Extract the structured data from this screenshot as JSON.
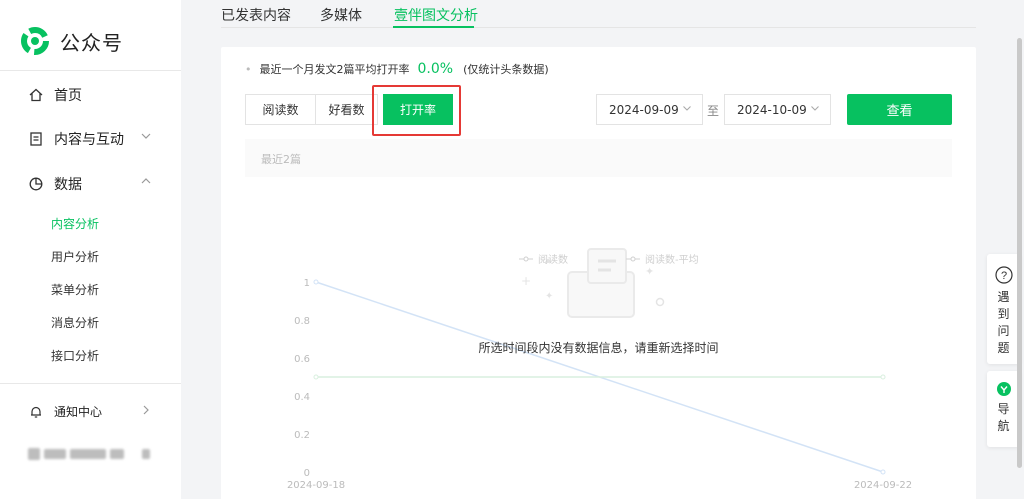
{
  "app": {
    "name": "公众号"
  },
  "sidebar": {
    "home": "首页",
    "content_interaction": "内容与互动",
    "data": "数据",
    "sub_items": [
      "内容分析",
      "用户分析",
      "菜单分析",
      "消息分析",
      "接口分析"
    ],
    "notifications": "通知中心"
  },
  "tabs": [
    "已发表内容",
    "多媒体",
    "壹伴图文分析"
  ],
  "summary": {
    "label": "最近一个月发文2篇平均打开率",
    "value": "0.0%",
    "note": "(仅统计头条数据)"
  },
  "segments": [
    "阅读数",
    "好看数",
    "打开率"
  ],
  "date_range": {
    "start": "2024-09-09",
    "to": "至",
    "end": "2024-10-09"
  },
  "view_button": "查看",
  "chart_header": "最近2篇",
  "empty_message": "所选时间段内没有数据信息，请重新选择时间",
  "right_float": {
    "help_chars": [
      "遇",
      "到",
      "问",
      "题"
    ],
    "nav_chars": [
      "导",
      "航"
    ]
  },
  "colors": {
    "accent": "#07c160",
    "highlight": "#e53935"
  },
  "chart_data": {
    "type": "line",
    "x": [
      "2024-09-18",
      "2024-09-22"
    ],
    "yticks": [
      "1",
      "0.8",
      "0.6",
      "0.4",
      "0.2",
      "0"
    ],
    "ylim": [
      0,
      1
    ],
    "series": [
      {
        "name": "阅读数",
        "values": [
          1,
          0
        ]
      },
      {
        "name": "阅读数-平均",
        "values": [
          0.5,
          0.5
        ]
      }
    ],
    "colors": [
      "#d3e3f6",
      "#d9efdf"
    ],
    "legend": "top-center"
  }
}
